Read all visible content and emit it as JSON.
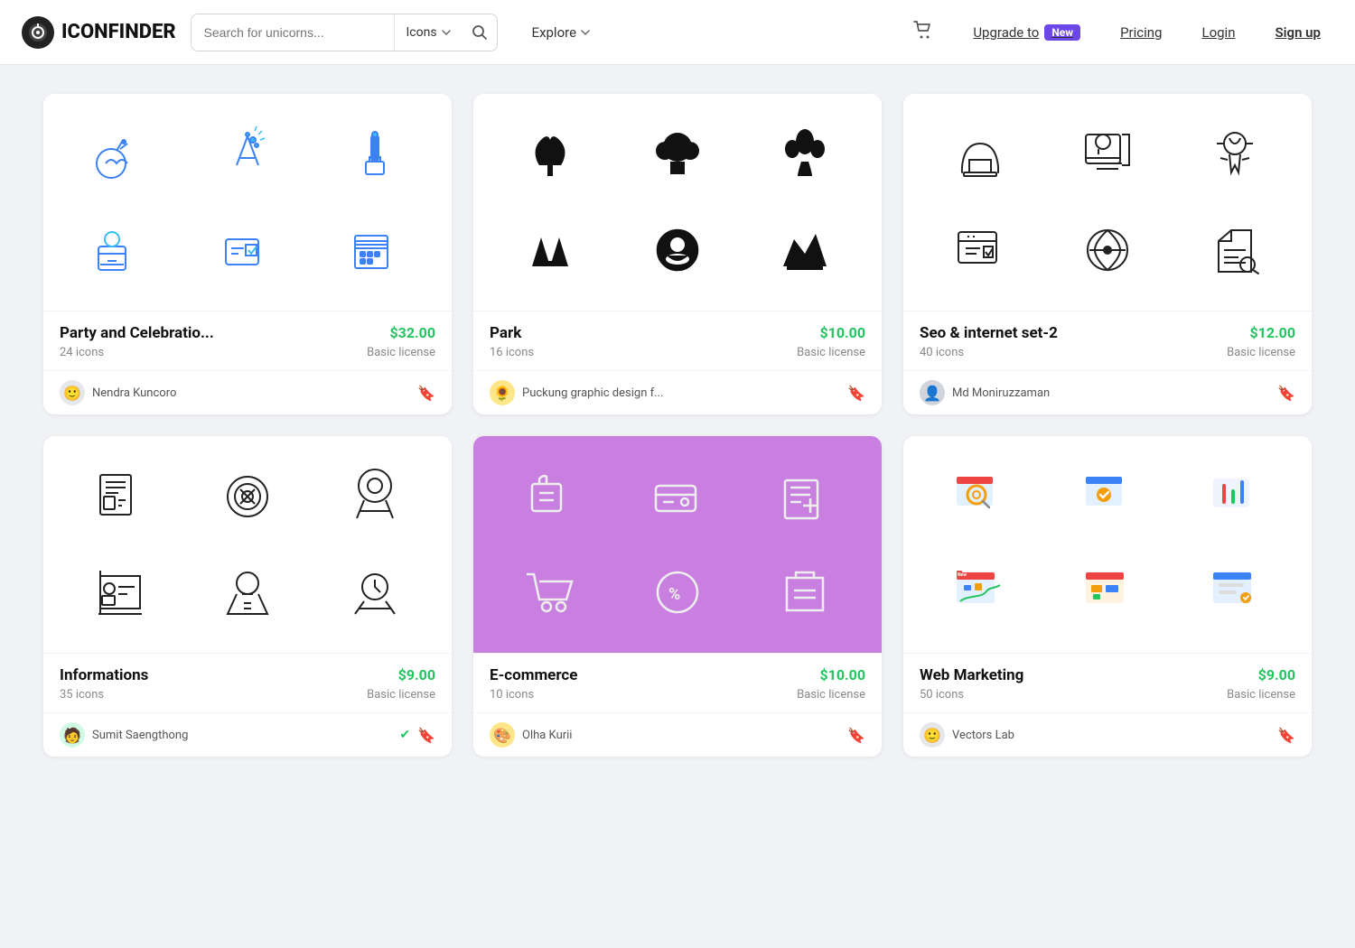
{
  "header": {
    "logo_text": "ICONFINDER",
    "search_placeholder": "Search for unicorns...",
    "search_type": "Icons",
    "nav_explore": "Explore",
    "nav_upgrade": "Upgrade to",
    "nav_new_badge": "New",
    "nav_pricing": "Pricing",
    "nav_login": "Login",
    "nav_signup": "Sign up"
  },
  "cards": [
    {
      "id": "party",
      "title": "Party and Celebratio...",
      "count": "24 icons",
      "price": "$32.00",
      "license": "Basic license",
      "author": "Nendra Kuncoro",
      "has_avatar": true,
      "bg": "white"
    },
    {
      "id": "park",
      "title": "Park",
      "count": "16 icons",
      "price": "$10.00",
      "license": "Basic license",
      "author": "Puckung graphic design f...",
      "has_avatar": true,
      "bg": "white"
    },
    {
      "id": "seo",
      "title": "Seo & internet set-2",
      "count": "40 icons",
      "price": "$12.00",
      "license": "Basic license",
      "author": "Md Moniruzzaman",
      "has_avatar": true,
      "bg": "white"
    },
    {
      "id": "informations",
      "title": "Informations",
      "count": "35 icons",
      "price": "$9.00",
      "license": "Basic license",
      "author": "Sumit Saengthong",
      "has_avatar": true,
      "verified": true,
      "bg": "white"
    },
    {
      "id": "ecommerce",
      "title": "E-commerce",
      "count": "10 icons",
      "price": "$10.00",
      "license": "Basic license",
      "author": "Olha Kurii",
      "has_avatar": true,
      "bg": "purple"
    },
    {
      "id": "webmarketing",
      "title": "Web Marketing",
      "count": "50 icons",
      "price": "$9.00",
      "license": "Basic license",
      "author": "Vectors Lab",
      "has_avatar": true,
      "bg": "white"
    }
  ]
}
